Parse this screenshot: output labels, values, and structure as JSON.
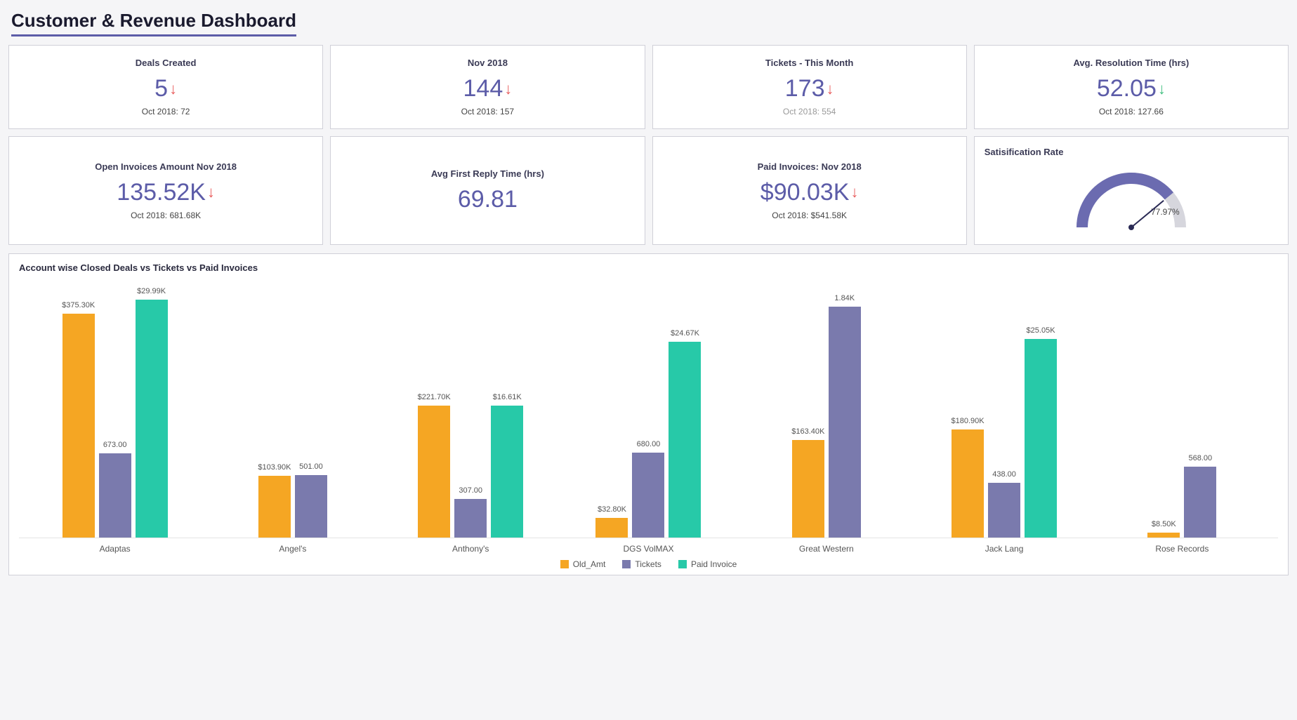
{
  "title": "Customer & Revenue Dashboard",
  "kpis": [
    {
      "title": "Deals Created",
      "value": "5",
      "arrow": "down-red",
      "sub": "Oct 2018: 72",
      "sub_muted": false
    },
    {
      "title": "Nov 2018",
      "value": "144",
      "arrow": "down-red",
      "sub": "Oct 2018: 157",
      "sub_muted": false
    },
    {
      "title": "Tickets - This Month",
      "value": "173",
      "arrow": "down-red",
      "sub": "Oct 2018: 554",
      "sub_muted": true
    },
    {
      "title": "Avg. Resolution Time (hrs)",
      "value": "52.05",
      "arrow": "down-green",
      "sub": "Oct 2018: 127.66",
      "sub_muted": false
    },
    {
      "title": "Open Invoices Amount Nov 2018",
      "value": "135.52K",
      "arrow": "down-red",
      "sub": "Oct 2018: 681.68K",
      "sub_muted": false
    },
    {
      "title": "Avg First Reply Time (hrs)",
      "value": "69.81",
      "arrow": "",
      "sub": "",
      "sub_muted": false
    },
    {
      "title": "Paid Invoices: Nov 2018",
      "value": "$90.03K",
      "arrow": "down-red",
      "sub": "Oct 2018: $541.58K",
      "sub_muted": false
    }
  ],
  "gauge": {
    "title": "Satisification Rate",
    "value": 77.97,
    "label": "77.97%"
  },
  "chart_data": {
    "type": "bar",
    "title": "Account wise Closed Deals vs Tickets vs Paid Invoices",
    "categories": [
      "Adaptas",
      "Angel's",
      "Anthony's",
      "DGS VolMAX",
      "Great Western",
      "Jack Lang",
      "Rose Records"
    ],
    "series": [
      {
        "name": "Old_Amt",
        "color": "#f5a623",
        "values_label": [
          "$375.30K",
          "$103.90K",
          "$221.70K",
          "$32.80K",
          "$163.40K",
          "$180.90K",
          "$8.50K"
        ],
        "values": [
          375.3,
          103.9,
          221.7,
          32.8,
          163.4,
          180.9,
          8.5
        ],
        "scale_max": 400
      },
      {
        "name": "Tickets",
        "color": "#7a7aad",
        "values_label": [
          "673.00",
          "501.00",
          "307.00",
          "680.00",
          "1.84K",
          "438.00",
          "568.00"
        ],
        "values": [
          673,
          501,
          307,
          680,
          1840,
          438,
          568
        ],
        "scale_max": 1900
      },
      {
        "name": "Paid Invoice",
        "color": "#27c9a8",
        "values_label": [
          "$29.99K",
          "",
          "$16.61K",
          "$24.67K",
          "",
          "$25.05K",
          ""
        ],
        "values": [
          29.99,
          0,
          16.61,
          24.67,
          0,
          25.05,
          0
        ],
        "scale_max": 30
      }
    ],
    "legend": [
      "Old_Amt",
      "Tickets",
      "Paid Invoice"
    ]
  },
  "colors": {
    "accent": "#5c5ca8",
    "orange": "#f5a623",
    "purple": "#7a7aad",
    "teal": "#27c9a8",
    "red": "#e85c5c",
    "green": "#3fbf7f"
  }
}
